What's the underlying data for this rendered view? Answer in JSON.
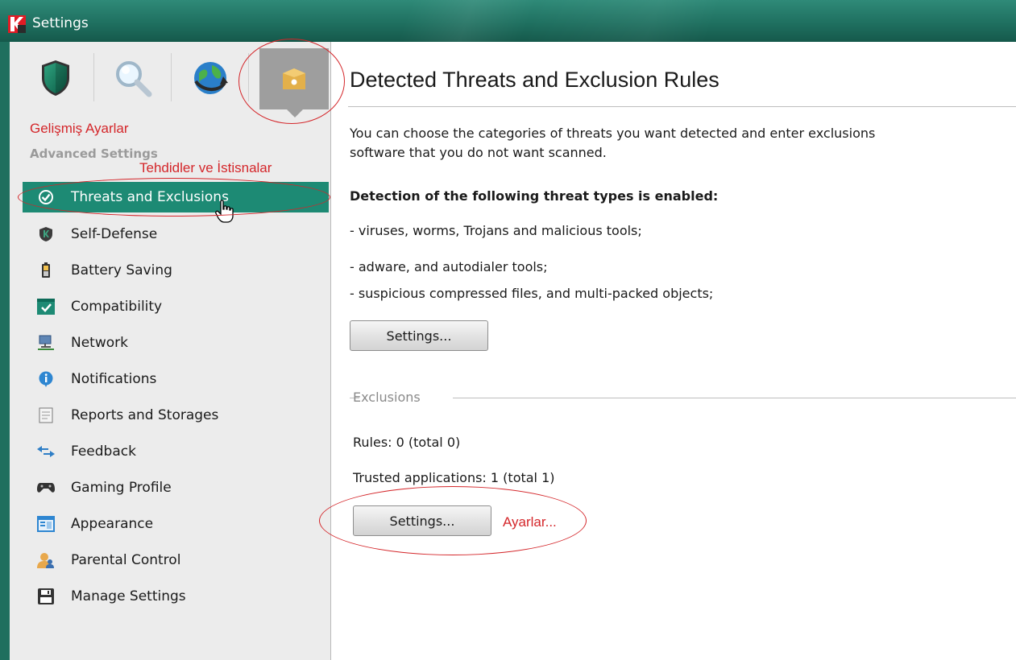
{
  "window": {
    "title": "Settings"
  },
  "toolbar": {
    "tabs": [
      {
        "name": "protection-tab",
        "icon": "shield-icon"
      },
      {
        "name": "scan-tab",
        "icon": "magnifier-icon"
      },
      {
        "name": "update-tab",
        "icon": "globe-update-icon"
      },
      {
        "name": "advanced-tab",
        "icon": "box-gear-icon",
        "active": true
      }
    ]
  },
  "sidebar": {
    "heading_annotation": "Gelişmiş Ayarlar",
    "heading": "Advanced Settings",
    "selected_annotation": "Tehdidler ve İstisnalar",
    "items": [
      {
        "label": "Threats and Exclusions",
        "icon": "check-circle-icon",
        "selected": true
      },
      {
        "label": "Self-Defense",
        "icon": "k-shield-icon"
      },
      {
        "label": "Battery Saving",
        "icon": "battery-icon"
      },
      {
        "label": "Compatibility",
        "icon": "window-check-icon"
      },
      {
        "label": "Network",
        "icon": "network-monitor-icon"
      },
      {
        "label": "Notifications",
        "icon": "info-bubble-icon"
      },
      {
        "label": "Reports and Storages",
        "icon": "report-document-icon"
      },
      {
        "label": "Feedback",
        "icon": "double-arrow-icon"
      },
      {
        "label": "Gaming Profile",
        "icon": "gamepad-icon"
      },
      {
        "label": "Appearance",
        "icon": "window-appearance-icon"
      },
      {
        "label": "Parental Control",
        "icon": "parental-user-icon"
      },
      {
        "label": "Manage Settings",
        "icon": "floppy-disk-icon"
      }
    ]
  },
  "content": {
    "title": "Detected Threats and Exclusion Rules",
    "description_line1": "You can choose the categories of threats you want detected and enter exclusions",
    "description_line2": "software that you do not want scanned.",
    "detection_heading": "Detection of the following threat types is enabled:",
    "threat_types": [
      "- viruses, worms, Trojans and malicious tools;",
      "- adware, and autodialer tools;",
      "- suspicious compressed files, and multi-packed objects;"
    ],
    "threats_settings_button": "Settings...",
    "exclusions_group": "Exclusions",
    "rules_text": "Rules: 0 (total 0)",
    "trusted_apps_text": "Trusted applications: 1 (total 1)",
    "exclusions_settings_button": "Settings...",
    "button_annotation": "Ayarlar..."
  },
  "colors": {
    "titlebar": "#1f7060",
    "selected_item": "#1d8a74",
    "annotation_red": "#d4262a"
  }
}
